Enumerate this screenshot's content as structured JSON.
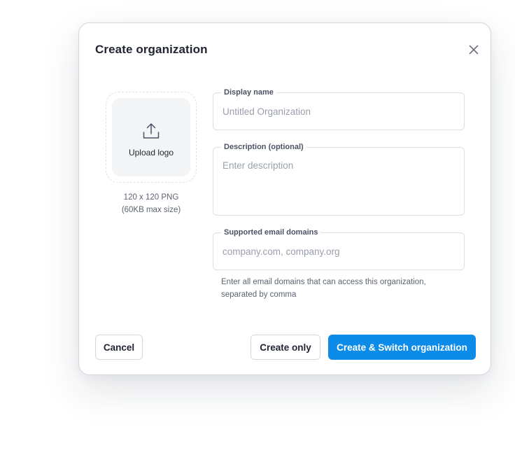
{
  "modal": {
    "title": "Create organization",
    "close_icon": "close-icon"
  },
  "logo_upload": {
    "icon": "upload-icon",
    "label": "Upload logo",
    "hint_line1": "120 x 120 PNG",
    "hint_line2": "(60KB max size)"
  },
  "form": {
    "display_name": {
      "label": "Display name",
      "placeholder": "Untitled Organization",
      "value": ""
    },
    "description": {
      "label": "Description (optional)",
      "placeholder": "Enter description",
      "value": ""
    },
    "email_domains": {
      "label": "Supported email domains",
      "placeholder": "company.com, company.org",
      "value": "",
      "help": "Enter all email domains that can access this organization, separated by comma"
    }
  },
  "actions": {
    "cancel_label": "Cancel",
    "create_only_label": "Create only",
    "create_switch_label": "Create & Switch organization"
  },
  "colors": {
    "primary": "#0d8be8",
    "text": "#1f2430",
    "muted": "#5d6472",
    "border": "#dcdfe4",
    "upload_bg": "#f3f4f6"
  }
}
